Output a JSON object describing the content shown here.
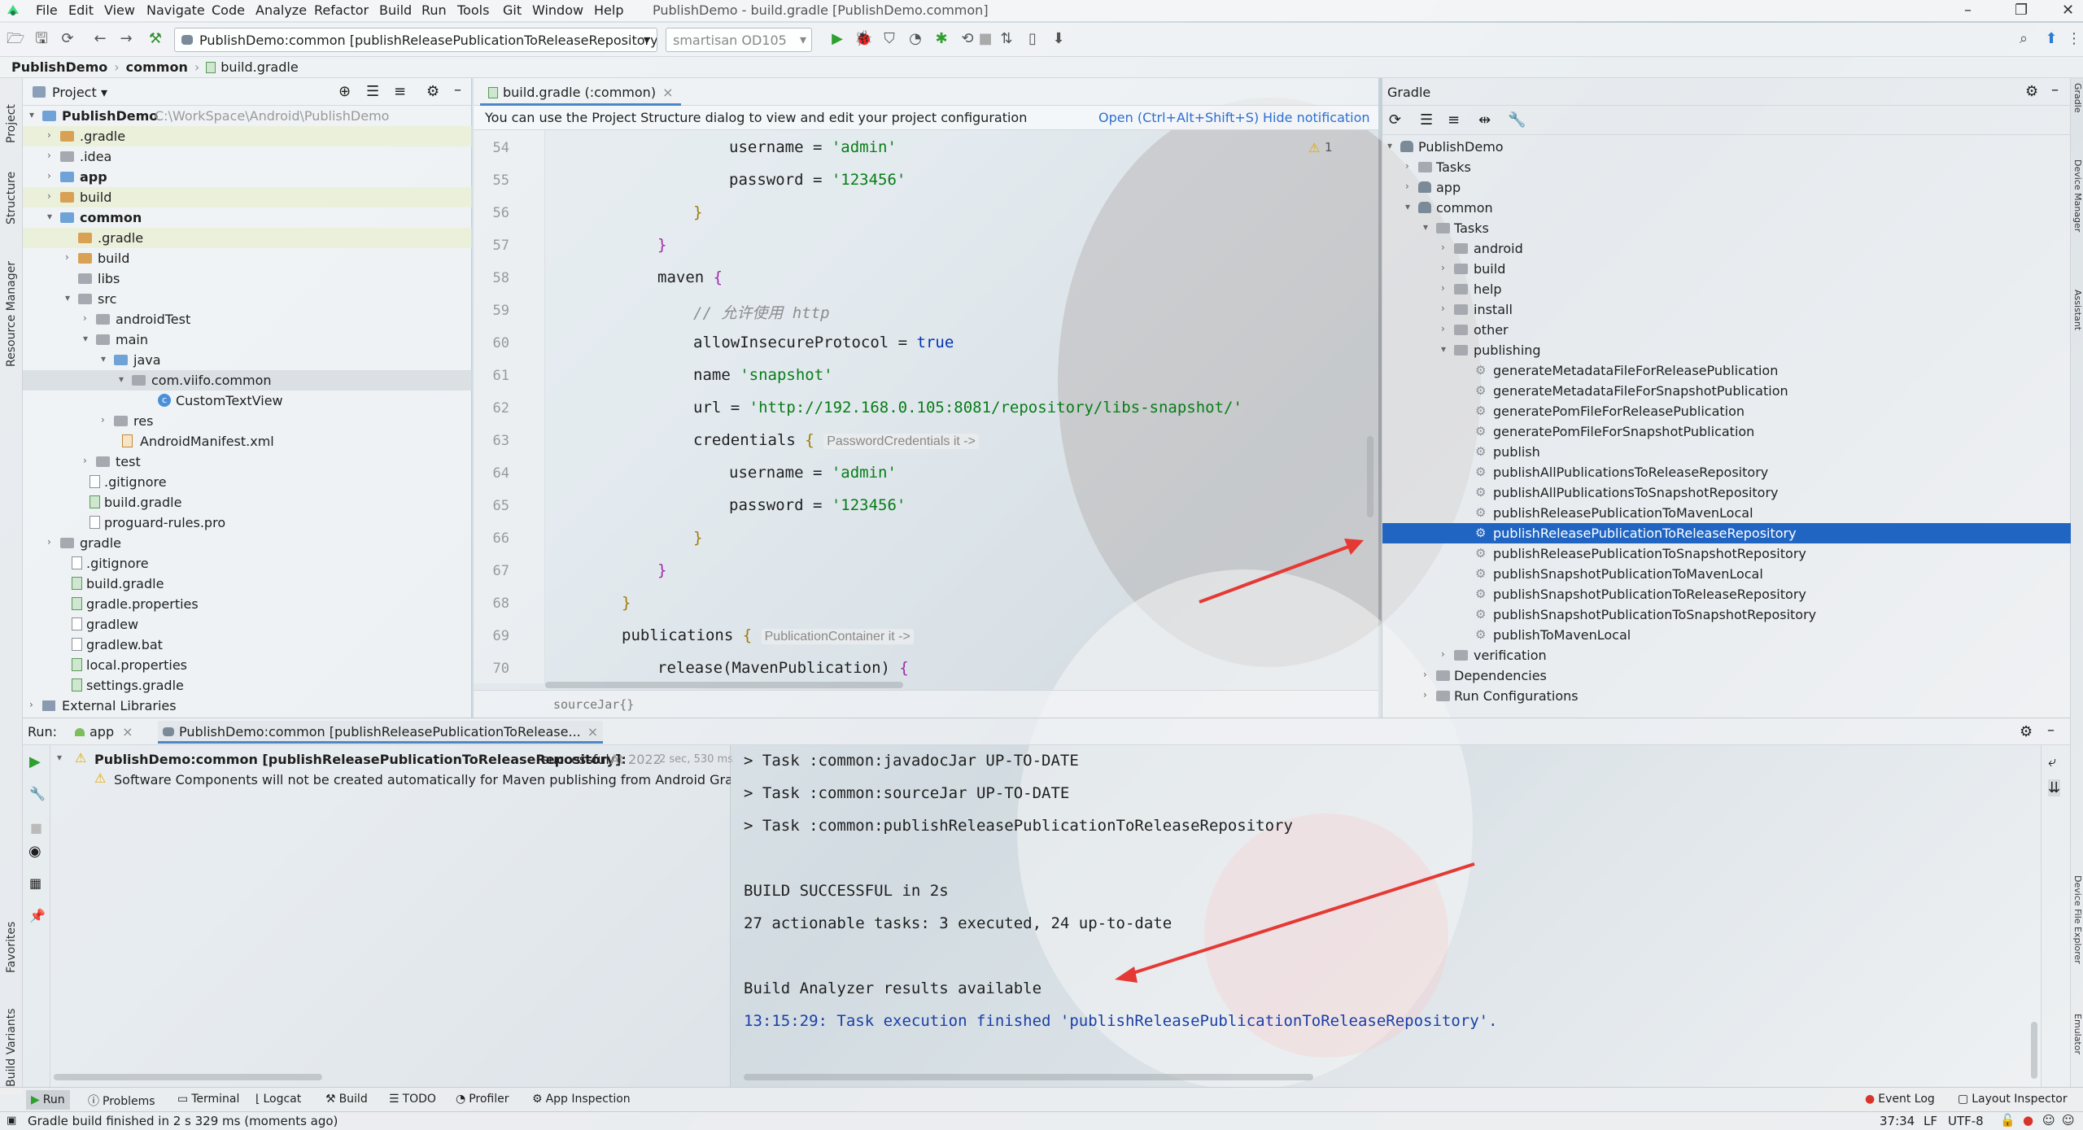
{
  "app": {
    "menu": [
      "File",
      "Edit",
      "View",
      "Navigate",
      "Code",
      "Analyze",
      "Refactor",
      "Build",
      "Run",
      "Tools",
      "Git",
      "Window",
      "Help"
    ],
    "window_title": "PublishDemo - build.gradle [PublishDemo.common]"
  },
  "toolbar": {
    "run_config": "PublishDemo:common [publishReleasePublicationToReleaseRepository]",
    "device": "smartisan OD105"
  },
  "breadcrumb": [
    "PublishDemo",
    "common",
    "build.gradle"
  ],
  "left_stripe": [
    "Project",
    "Structure",
    "Resource Manager",
    "Favorites",
    "Build Variants"
  ],
  "right_stripe": [
    "Gradle",
    "Device Manager",
    "Assistant",
    "Device File Explorer",
    "Emulator"
  ],
  "project": {
    "header": "Project",
    "tree": [
      {
        "label": "PublishDemo",
        "extra": "C:\\WorkSpace\\Android\\PublishDemo"
      },
      {
        "label": ".gradle"
      },
      {
        "label": ".idea"
      },
      {
        "label": "app"
      },
      {
        "label": "build"
      },
      {
        "label": "common"
      },
      {
        "label": ".gradle"
      },
      {
        "label": "build"
      },
      {
        "label": "libs"
      },
      {
        "label": "src"
      },
      {
        "label": "androidTest"
      },
      {
        "label": "main"
      },
      {
        "label": "java"
      },
      {
        "label": "com.viifo.common"
      },
      {
        "label": "CustomTextView"
      },
      {
        "label": "res"
      },
      {
        "label": "AndroidManifest.xml"
      },
      {
        "label": "test"
      },
      {
        "label": ".gitignore"
      },
      {
        "label": "build.gradle"
      },
      {
        "label": "proguard-rules.pro"
      },
      {
        "label": "gradle"
      },
      {
        "label": ".gitignore"
      },
      {
        "label": "build.gradle"
      },
      {
        "label": "gradle.properties"
      },
      {
        "label": "gradlew"
      },
      {
        "label": "gradlew.bat"
      },
      {
        "label": "local.properties"
      },
      {
        "label": "settings.gradle"
      },
      {
        "label": "External Libraries"
      }
    ]
  },
  "editor": {
    "tab": "build.gradle (:common)",
    "notification": "You can use the Project Structure dialog to view and edit your project configuration",
    "notification_open": "Open (Ctrl+Alt+Shift+S)",
    "notification_hide": "Hide notification",
    "warning_count": "1",
    "line_numbers": [
      "54",
      "55",
      "56",
      "57",
      "58",
      "59",
      "60",
      "61",
      "62",
      "63",
      "64",
      "65",
      "66",
      "67",
      "68",
      "69",
      "70"
    ],
    "footer": "sourceJar{}",
    "code": {
      "l54_a": "username = ",
      "l54_b": "'admin'",
      "l55_a": "password = ",
      "l55_b": "'123456'",
      "l56": "}",
      "l57": "}",
      "l58_a": "maven ",
      "l58_b": "{",
      "l59": "// 允许使用 http",
      "l60_a": "allowInsecureProtocol = ",
      "l60_b": "true",
      "l61_a": "name ",
      "l61_b": "'snapshot'",
      "l62_a": "url = ",
      "l62_b": "'http://192.168.0.105:8081/repository/libs-snapshot/'",
      "l63_a": "credentials ",
      "l63_b": "{",
      "l63_hint": "PasswordCredentials it ->",
      "l64_a": "username = ",
      "l64_b": "'admin'",
      "l65_a": "password = ",
      "l65_b": "'123456'",
      "l66": "}",
      "l67": "}",
      "l68": "}",
      "l69_a": "publications ",
      "l69_b": "{",
      "l69_hint": "PublicationContainer it ->",
      "l70_a": "release(MavenPublication) ",
      "l70_b": "{"
    }
  },
  "gradle": {
    "header": "Gradle",
    "tree": [
      {
        "label": "PublishDemo"
      },
      {
        "label": "Tasks"
      },
      {
        "label": "app"
      },
      {
        "label": "common"
      },
      {
        "label": "Tasks"
      },
      {
        "label": "android"
      },
      {
        "label": "build"
      },
      {
        "label": "help"
      },
      {
        "label": "install"
      },
      {
        "label": "other"
      },
      {
        "label": "publishing"
      },
      {
        "label": "generateMetadataFileForReleasePublication"
      },
      {
        "label": "generateMetadataFileForSnapshotPublication"
      },
      {
        "label": "generatePomFileForReleasePublication"
      },
      {
        "label": "generatePomFileForSnapshotPublication"
      },
      {
        "label": "publish"
      },
      {
        "label": "publishAllPublicationsToReleaseRepository"
      },
      {
        "label": "publishAllPublicationsToSnapshotRepository"
      },
      {
        "label": "publishReleasePublicationToMavenLocal"
      },
      {
        "label": "publishReleasePublicationToReleaseRepository"
      },
      {
        "label": "publishReleasePublicationToSnapshotRepository"
      },
      {
        "label": "publishSnapshotPublicationToMavenLocal"
      },
      {
        "label": "publishSnapshotPublicationToReleaseRepository"
      },
      {
        "label": "publishSnapshotPublicationToSnapshotRepository"
      },
      {
        "label": "publishToMavenLocal"
      },
      {
        "label": "verification"
      },
      {
        "label": "Dependencies"
      },
      {
        "label": "Run Configurations"
      }
    ]
  },
  "run": {
    "label": "Run:",
    "tab_app": "app",
    "tab_config": "PublishDemo:common [publishReleasePublicationToRelease...",
    "result_title": "PublishDemo:common [publishReleasePublicationToReleaseRepository]:",
    "result_status": "successful",
    "result_time": "At 2022",
    "result_duration": "2 sec, 530 ms",
    "warning_text": "Software Components will not be created automatically for Maven publishing from Android Gradle Plug",
    "console": [
      "> Task :common:javadocJar UP-TO-DATE",
      "> Task :common:sourceJar UP-TO-DATE",
      "> Task :common:publishReleasePublicationToReleaseRepository",
      "",
      "BUILD SUCCESSFUL in 2s",
      "27 actionable tasks: 3 executed, 24 up-to-date",
      "",
      "Build Analyzer results available",
      "13:15:29: Task execution finished 'publishReleasePublicationToReleaseRepository'."
    ]
  },
  "tool_windows": [
    "Run",
    "Problems",
    "Terminal",
    "Logcat",
    "Build",
    "TODO",
    "Profiler",
    "App Inspection"
  ],
  "tool_windows_right": [
    "Event Log",
    "Layout Inspector"
  ],
  "status": {
    "message": "Gradle build finished in 2 s 329 ms (moments ago)",
    "position": "37:34",
    "line_sep": "LF",
    "encoding": "UTF-8"
  },
  "colors": {
    "selection": "#2165c3",
    "annotation_arrow": "#e53935",
    "string": "#067d17",
    "keyword": "#0033b3"
  }
}
